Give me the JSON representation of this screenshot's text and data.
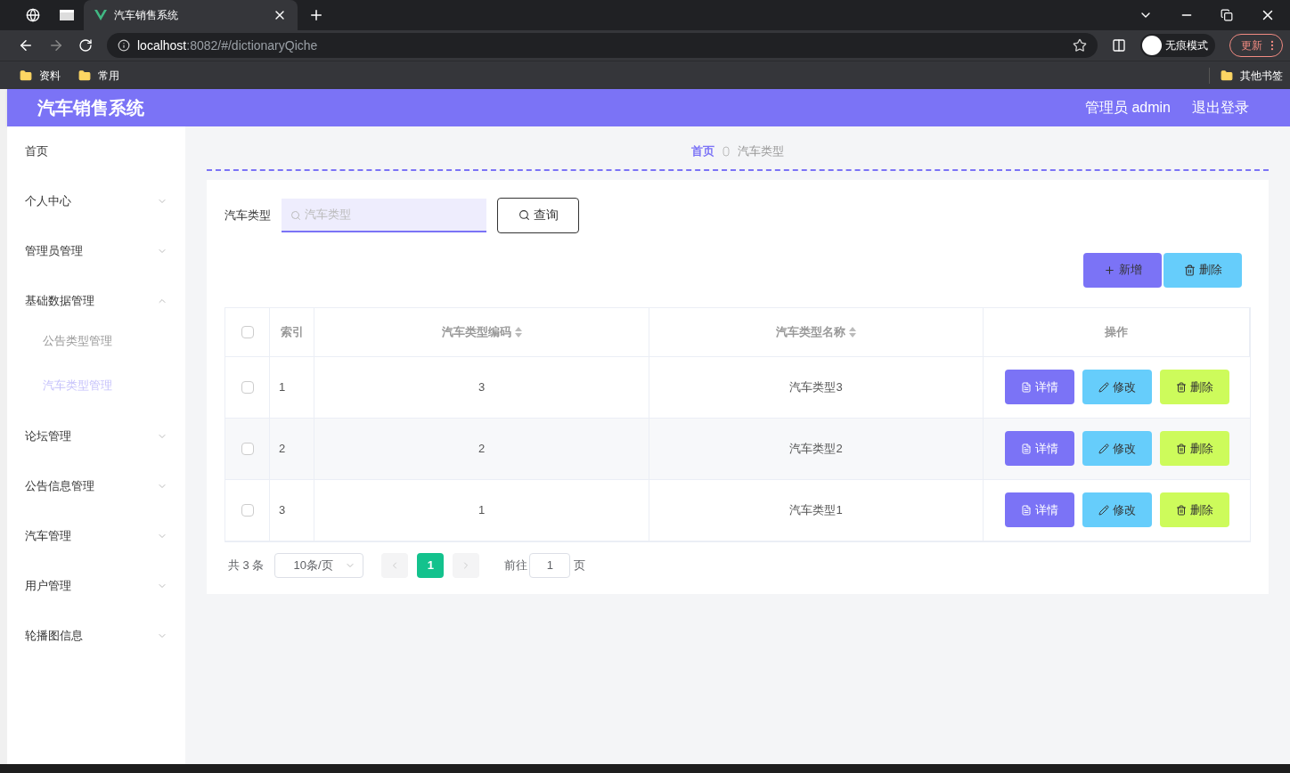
{
  "browser": {
    "tabs": [
      {
        "kind": "globe",
        "selected": false
      },
      {
        "kind": "window",
        "selected": false
      },
      {
        "kind": "page",
        "title": "汽车销售系统",
        "selected": true
      }
    ],
    "url_host": "localhost",
    "url_path": ":8082/#/dictionaryQiche",
    "incognito": "无痕模式",
    "update": "更新",
    "bookmarks": [
      "资料",
      "常用"
    ],
    "other_bookmarks": "其他书签"
  },
  "header": {
    "title": "汽车销售系统",
    "user": "管理员 admin",
    "logout": "退出登录"
  },
  "sidebar": {
    "items": [
      {
        "label": "首页",
        "kind": "link"
      },
      {
        "label": "个人中心",
        "kind": "menu",
        "expanded": false
      },
      {
        "label": "管理员管理",
        "kind": "menu",
        "expanded": false
      },
      {
        "label": "基础数据管理",
        "kind": "menu",
        "expanded": true,
        "children": [
          {
            "label": "公告类型管理",
            "selected": false
          },
          {
            "label": "汽车类型管理",
            "selected": true
          }
        ]
      },
      {
        "label": "论坛管理",
        "kind": "menu",
        "expanded": false
      },
      {
        "label": "公告信息管理",
        "kind": "menu",
        "expanded": false
      },
      {
        "label": "汽车管理",
        "kind": "menu",
        "expanded": false
      },
      {
        "label": "用户管理",
        "kind": "menu",
        "expanded": false
      },
      {
        "label": "轮播图信息",
        "kind": "menu",
        "expanded": false
      }
    ]
  },
  "breadcrumb": [
    "首页",
    "汽车类型"
  ],
  "search": {
    "label": "汽车类型",
    "placeholder": "汽车类型",
    "button": "查询"
  },
  "actions": [
    "新增",
    "删除"
  ],
  "table": {
    "columns": [
      "索引",
      "汽车类型编码",
      "汽车类型名称",
      "操作"
    ],
    "rows": [
      {
        "checked": false,
        "index": "1",
        "code": "3",
        "name": "汽车类型3",
        "buttons": [
          "详情",
          "修改",
          "删除"
        ]
      },
      {
        "checked": false,
        "index": "2",
        "code": "2",
        "name": "汽车类型2",
        "buttons": [
          "详情",
          "修改",
          "删除"
        ]
      },
      {
        "checked": false,
        "index": "3",
        "code": "1",
        "name": "汽车类型1",
        "buttons": [
          "详情",
          "修改",
          "删除"
        ]
      }
    ],
    "all_checked": false
  },
  "pagination": {
    "total": "共 3 条",
    "page_size": "10条/页",
    "pages": [
      {
        "label": "1",
        "selected": true
      }
    ],
    "goto": "前往",
    "goto_value": "1",
    "page_unit": "页"
  }
}
